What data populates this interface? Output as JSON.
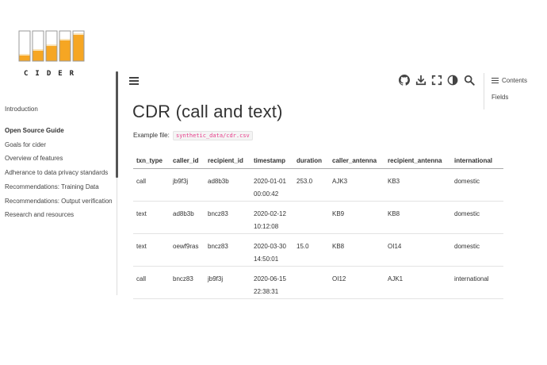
{
  "logo": {
    "text": "CIDER",
    "colors": {
      "fill": "#f6a623",
      "outline": "#999999"
    }
  },
  "sidebar": {
    "items": [
      {
        "label": "Introduction"
      },
      {
        "label": "Open Source Guide"
      },
      {
        "label": "Goals for cider"
      },
      {
        "label": "Overview of features"
      },
      {
        "label": "Adherance to data privacy standards"
      },
      {
        "label": "Recommendations: Training Data"
      },
      {
        "label": "Recommendations: Output verification"
      },
      {
        "label": "Research and resources"
      }
    ]
  },
  "header": {
    "icons": [
      "menu-icon",
      "github-icon",
      "download-icon",
      "fullscreen-icon",
      "theme-toggle-icon",
      "search-icon"
    ]
  },
  "toc": {
    "title": "Contents",
    "items": [
      "Fields"
    ]
  },
  "main": {
    "title": "CDR (call and text)",
    "example_label": "Example file:",
    "example_path": "synthetic_data/cdr.csv"
  },
  "table": {
    "headers": [
      "txn_type",
      "caller_id",
      "recipient_id",
      "timestamp",
      "duration",
      "caller_antenna",
      "recipient_antenna",
      "international"
    ],
    "rows": [
      [
        "call",
        "jb9f3j",
        "ad8b3b",
        "2020-01-01 00:00:42",
        "253.0",
        "AJK3",
        "KB3",
        "domestic"
      ],
      [
        "text",
        "ad8b3b",
        "bncz83",
        "2020-02-12 10:12:08",
        "",
        "KB9",
        "KB8",
        "domestic"
      ],
      [
        "text",
        "oewf9ras",
        "bncz83",
        "2020-03-30 14:50:01",
        "15.0",
        "KB8",
        "OI14",
        "domestic"
      ],
      [
        "call",
        "bncz83",
        "jb9f3j",
        "2020-06-15 22:38:31",
        "",
        "OI12",
        "AJK1",
        "international"
      ]
    ]
  },
  "colors": {
    "accent": "#e83e8c",
    "scrollbar": "#555555"
  }
}
